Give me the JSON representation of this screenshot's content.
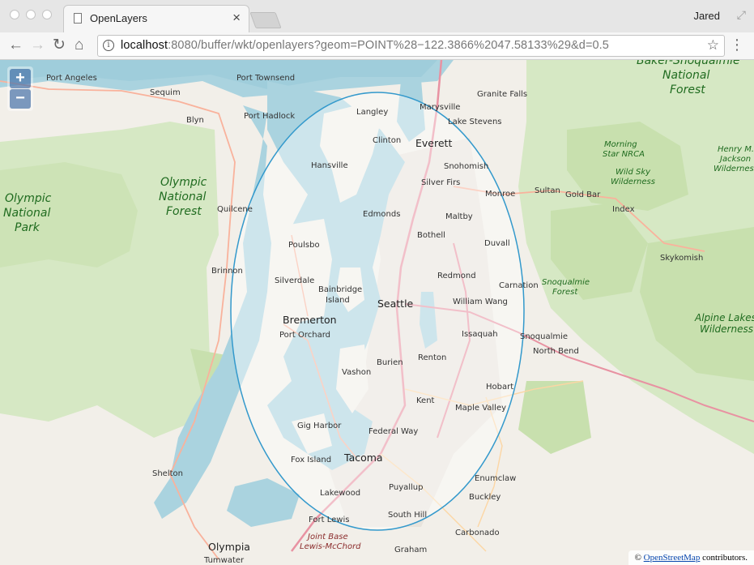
{
  "browser": {
    "tab_title": "OpenLayers",
    "tab_close": "×",
    "profile_name": "Jared",
    "url_host": "localhost",
    "url_rest": ":8080/buffer/wkt/openlayers?geom=POINT%28−122.3866%2047.58133%29&d=0.5",
    "nav": {
      "back": "←",
      "forward": "→",
      "reload": "↻",
      "home": "⌂",
      "info": "i",
      "star": "☆",
      "menu": "⋮",
      "fullscreen": "⤢"
    }
  },
  "map": {
    "zoom_in": "+",
    "zoom_out": "−",
    "attribution_prefix": "© ",
    "attribution_link": "OpenStreetMap",
    "attribution_suffix": " contributors.",
    "colors": {
      "land": "#f2efe9",
      "water": "#aad3df",
      "forest": "#c8e2b0",
      "buffer_stroke": "#3399cc",
      "buffer_fill": "rgba(255,255,255,0.4)"
    },
    "places": {
      "port_angeles": "Port Angeles",
      "sequim": "Sequim",
      "blyn": "Blyn",
      "port_townsend": "Port Townsend",
      "port_hadlock": "Port Hadlock",
      "langley": "Langley",
      "marysville": "Marysville",
      "granite_falls": "Granite Falls",
      "lake_stevens": "Lake Stevens",
      "clinton": "Clinton",
      "everett": "Everett",
      "hansville": "Hansville",
      "snohomish": "Snohomish",
      "silver_firs": "Silver Firs",
      "monroe": "Monroe",
      "sultan": "Sultan",
      "gold_bar": "Gold Bar",
      "index": "Index",
      "quilcene": "Quilcene",
      "edmonds": "Edmonds",
      "maltby": "Maltby",
      "bothell": "Bothell",
      "poulsbo": "Poulsbo",
      "duvall": "Duvall",
      "brinnon": "Brinnon",
      "skykomish": "Skykomish",
      "silverdale": "Silverdale",
      "redmond": "Redmond",
      "carnation": "Carnation",
      "bainbridge_island_1": "Bainbridge",
      "bainbridge_island_2": "Island",
      "seattle": "Seattle",
      "william_wang": "William Wang",
      "bremerton": "Bremerton",
      "port_orchard": "Port Orchard",
      "issaquah": "Issaquah",
      "snoqualmie": "Snoqualmie",
      "north_bend": "North Bend",
      "burien": "Burien",
      "renton": "Renton",
      "vashon": "Vashon",
      "hobart": "Hobart",
      "kent": "Kent",
      "maple_valley": "Maple Valley",
      "gig_harbor": "Gig Harbor",
      "federal_way": "Federal Way",
      "fox_island": "Fox Island",
      "tacoma": "Tacoma",
      "enumclaw": "Enumclaw",
      "shelton": "Shelton",
      "puyallup": "Puyallup",
      "buckley": "Buckley",
      "lakewood": "Lakewood",
      "fort_lewis": "Fort Lewis",
      "south_hill": "South Hill",
      "carbonado": "Carbonado",
      "olympia": "Olympia",
      "graham": "Graham",
      "tumwater": "Tumwater"
    },
    "areas": {
      "olympic_nf_1": "Olympic",
      "olympic_nf_2": "National",
      "olympic_nf_3": "Forest",
      "olympic_np_1": "Olympic",
      "olympic_np_2": "National",
      "olympic_np_3": "Park",
      "baker_1": "Baker-Snoqualmie",
      "baker_2": "National",
      "baker_3": "Forest",
      "morning_star_1": "Morning",
      "morning_star_2": "Star NRCA",
      "wild_sky_1": "Wild Sky",
      "wild_sky_2": "Wilderness",
      "henry_jackson_1": "Henry M.",
      "henry_jackson_2": "Jackson",
      "henry_jackson_3": "Wilderness",
      "snoqualmie_forest_1": "Snoqualmie",
      "snoqualmie_forest_2": "Forest",
      "alpine_lakes_1": "Alpine Lakes",
      "alpine_lakes_2": "Wilderness",
      "jblm_1": "Joint Base",
      "jblm_2": "Lewis-McChord"
    }
  }
}
